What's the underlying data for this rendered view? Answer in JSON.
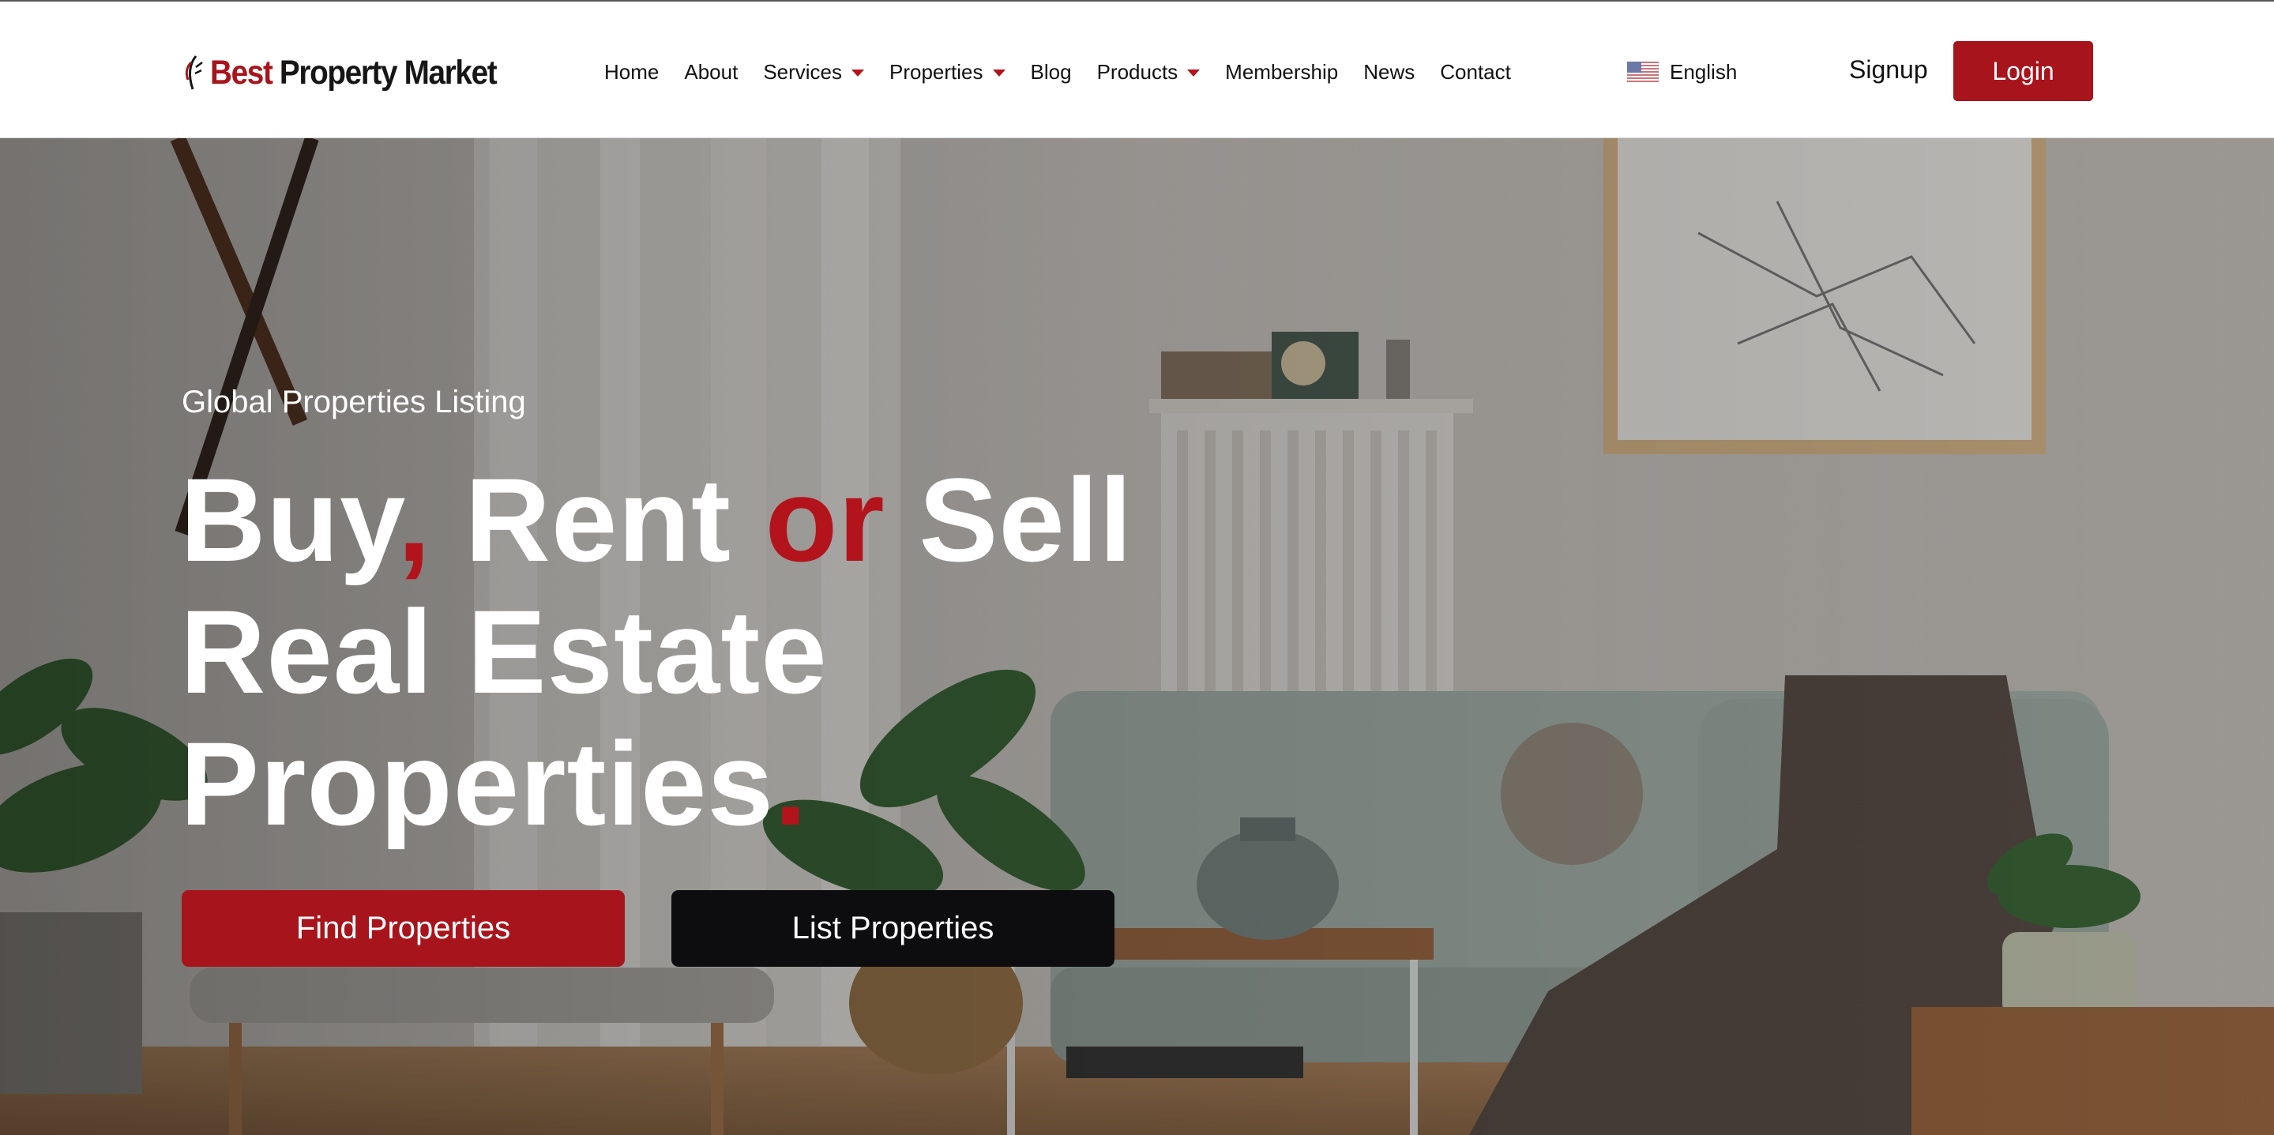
{
  "brand": {
    "logo_part1": "Best",
    "logo_part2": "Property Market",
    "accent_color": "#a8141c"
  },
  "nav": {
    "items": [
      {
        "label": "Home",
        "dropdown": false
      },
      {
        "label": "About",
        "dropdown": false
      },
      {
        "label": "Services",
        "dropdown": true
      },
      {
        "label": "Properties",
        "dropdown": true
      },
      {
        "label": "Blog",
        "dropdown": false
      },
      {
        "label": "Products",
        "dropdown": true
      },
      {
        "label": "Membership",
        "dropdown": false
      },
      {
        "label": "News",
        "dropdown": false
      },
      {
        "label": "Contact",
        "dropdown": false
      }
    ]
  },
  "language": {
    "label": "English",
    "flag_icon": "us-flag-icon"
  },
  "auth": {
    "signup_label": "Signup",
    "login_label": "Login"
  },
  "hero": {
    "eyebrow": "Global Properties Listing",
    "title": {
      "w1": "Buy",
      "comma": ",",
      "w2": "Rent",
      "w3": "or",
      "w4": "Sell",
      "line2": "Real Estate",
      "line3": "Properties",
      "period": "."
    },
    "find_button": "Find Properties",
    "list_button": "List Properties"
  }
}
